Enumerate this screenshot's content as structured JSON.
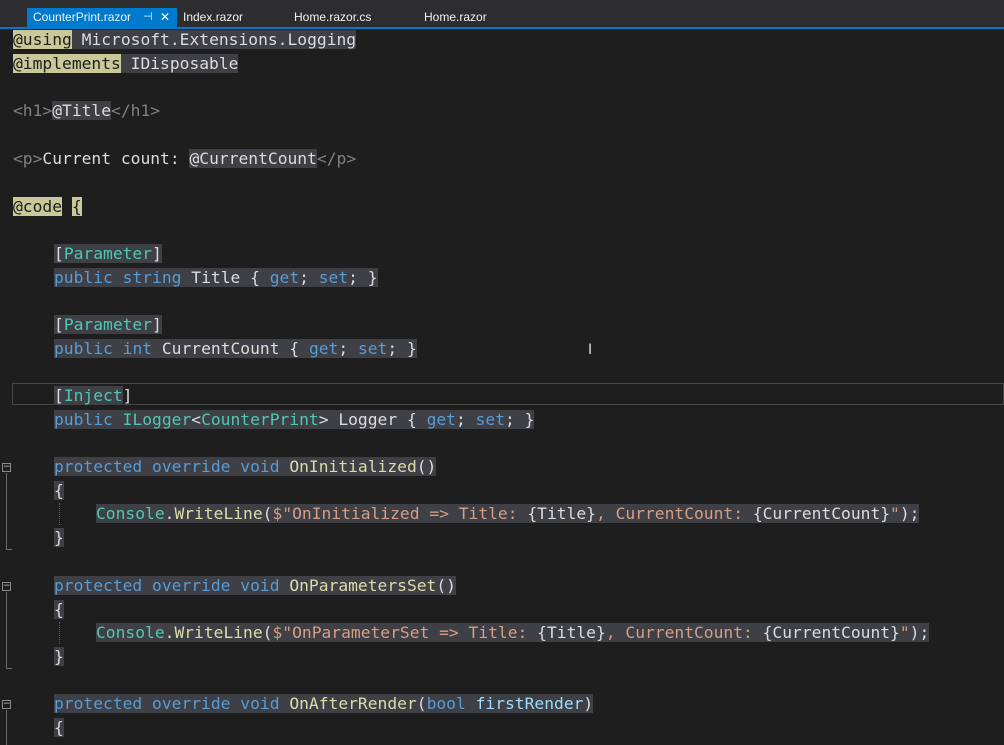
{
  "tabs": [
    {
      "label": "CounterPrint.razor",
      "active": true,
      "pin_icon": "pin-icon",
      "close_icon": "close-icon"
    },
    {
      "label": "Index.razor"
    },
    {
      "label": "Home.razor.cs"
    },
    {
      "label": "Home.razor"
    }
  ],
  "code": {
    "using_kw": "@using",
    "using_ns": "Microsoft.Extensions.Logging",
    "implements_kw": "@implements",
    "implements_type": "IDisposable",
    "h1_open": "<h1>",
    "title_expr": "@Title",
    "h1_close": "</h1>",
    "p_open": "<p>",
    "p_text": "Current count: ",
    "count_expr": "@CurrentCount",
    "p_close": "</p>",
    "code_kw": "@code",
    "open_brace": "{",
    "attr_parameter": "Parameter",
    "attr_inject": "Inject",
    "kw_public": "public",
    "kw_string": "string",
    "kw_int": "int",
    "prop_title": "Title",
    "prop_count": "CurrentCount",
    "prop_logger": "Logger",
    "kw_get": "get",
    "kw_set": "set",
    "type_ilogger": "ILogger",
    "type_counterprint": "CounterPrint",
    "kw_protected": "protected",
    "kw_override": "override",
    "kw_void": "void",
    "kw_bool": "bool",
    "method_oninit": "OnInitialized",
    "method_onparams": "OnParametersSet",
    "method_onafter": "OnAfterRender",
    "param_first": "firstRender",
    "type_console": "Console",
    "method_writeline": "WriteLine",
    "str_init_a": "$\"OnInitialized => Title: ",
    "str_param_a": "$\"OnParameterSet => Title: ",
    "str_b": ", CurrentCount: ",
    "interp_title": "{Title}",
    "interp_count": "{CurrentCount}",
    "str_end": "\""
  }
}
